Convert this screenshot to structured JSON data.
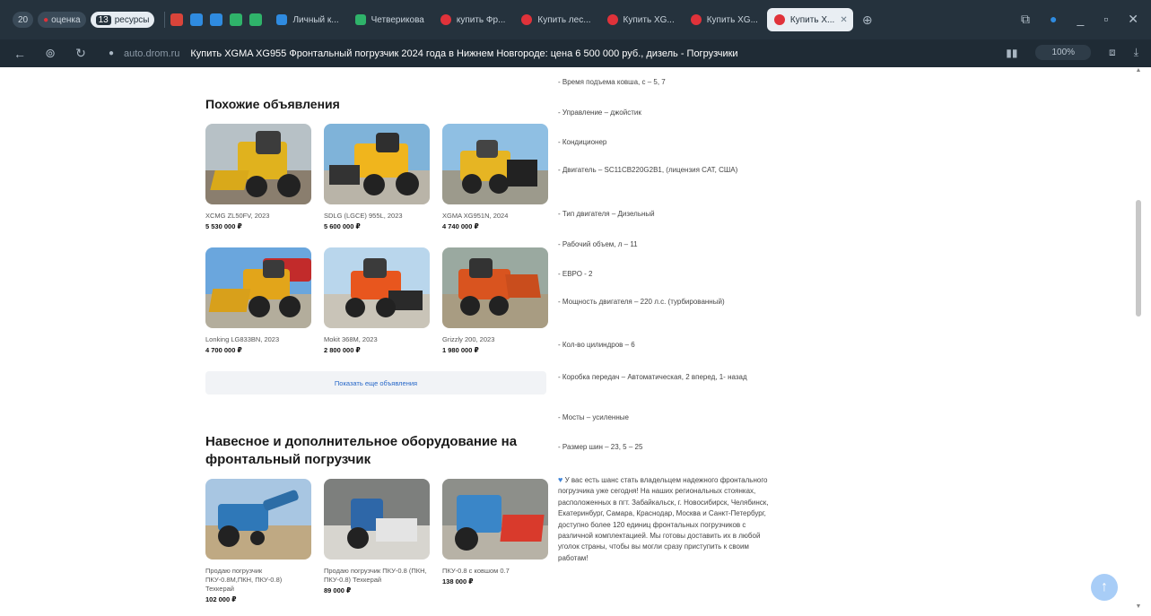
{
  "browser": {
    "tab_count": "20",
    "pill_1": "оценка",
    "pill_2_count": "13",
    "pill_2": "ресурсы",
    "tabs": [
      {
        "label": "Личный к...",
        "color": "#2f8be0"
      },
      {
        "label": "Четверикова",
        "color": "#2fb36a"
      },
      {
        "label": "купить Фр...",
        "color": "#e0323a"
      },
      {
        "label": "Купить лес...",
        "color": "#e0323a"
      },
      {
        "label": "Купить XG...",
        "color": "#e0323a"
      },
      {
        "label": "Купить XG...",
        "color": "#e0323a"
      },
      {
        "label": "Купить X...",
        "color": "#e0323a",
        "active": true
      }
    ],
    "url_domain": "auto.drom.ru",
    "page_title": "Купить XGMA XG955 Фронтальный погрузчик 2024 года в Нижнем Новгороде: цена 6 500 000 руб., дизель - Погрузчики",
    "zoom": "100%"
  },
  "similar": {
    "title": "Похожие объявления",
    "items": [
      {
        "name": "XCMG ZL50FV, 2023",
        "price": "5 530 000 ₽"
      },
      {
        "name": "SDLG (LGCE) 955L, 2023",
        "price": "5 600 000 ₽"
      },
      {
        "name": "XGMA XG951N, 2024",
        "price": "4 740 000 ₽"
      },
      {
        "name": "Lonking LG833BN, 2023",
        "price": "4 700 000 ₽"
      },
      {
        "name": "Mokit 368M, 2023",
        "price": "2 800 000 ₽"
      },
      {
        "name": "Grizzly 200, 2023",
        "price": "1 980 000 ₽"
      }
    ],
    "show_more": "Показать еще объявления"
  },
  "attachments": {
    "title": "Навесное и дополнительное оборудование на фронтальный погрузчик",
    "items": [
      {
        "name": "Продаю погрузчик ПКУ-0.8М,ПКН, ПКУ-0.8) Техкерай",
        "price": "102 000 ₽"
      },
      {
        "name": "Продаю погрузчик ПКУ-0.8 (ПКН, ПКУ-0.8) Техкерай",
        "price": "89 000 ₽"
      },
      {
        "name": "ПКУ-0.8 с ковшом 0.7",
        "price": "138 000 ₽"
      }
    ]
  },
  "specs": [
    "- Время подъема ковша, с – 5, 7",
    "- Управление – джойстик",
    "- Кондиционер",
    "- Двигатель – SC11CB220G2B1, (лицензия CAT, США)",
    "- Тип двигателя – Дизельный",
    "- Рабочий объем, л – 11",
    "- ЕВРО - 2",
    "- Мощность двигателя – 220 л.с. (турбированный)",
    "- Кол-во цилиндров – 6",
    "- Коробка передач – Автоматическая, 2 вперед, 1- назад",
    "- Мосты – усиленные",
    "- Размер шин – 23, 5 – 25"
  ],
  "promo": "У вас есть шанс стать владельцем надежного фронтального погрузчика уже сегодня! На наших региональных стоянках, расположенных в пгт. Забайкальск, г. Новосибирск, Челябинск, Екатеринбург, Самара, Краснодар, Москва и Санкт-Петербург, доступно более 120 единиц фронтальных погрузчиков с различной комплектацией. Мы готовы доставить их в любой уголок страны, чтобы вы могли сразу приступить к своим работам!",
  "colors": {
    "accent": "#2667c8",
    "chrome_dark": "#25323d",
    "brand_red": "#e0323a"
  }
}
